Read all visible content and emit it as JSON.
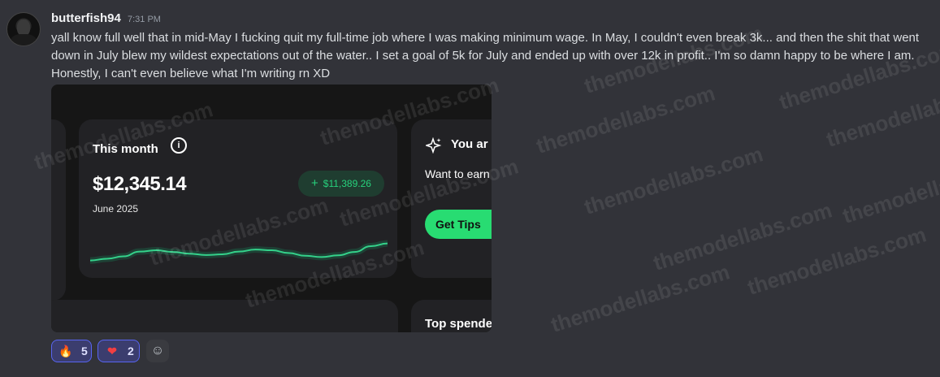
{
  "message": {
    "username": "butterfish94",
    "timestamp": "7:31 PM",
    "text": "yall know full well that in mid-May I fucking quit my full-time job where I was making minimum wage. In May, I couldn't even break 3k... and then the shit that went down in July blew my wildest expectations out of the water.. I set a goal of 5k for July and ended up with over 12k in profit.. I'm so damn happy to be where I am. Honestly, I can't even believe what I'm writing rn XD"
  },
  "embed": {
    "this_month_title": "This month",
    "info_icon": "i",
    "amount": "$12,345.14",
    "month": "June 2025",
    "gain_badge": "$11,389.26",
    "gain_plus": "+",
    "right_title": "You ar",
    "right_text": "Want to earn increased re",
    "tips_button": "Get Tips",
    "top_spend": "Top spende",
    "sparkline_values": [
      0.2,
      0.25,
      0.32,
      0.46,
      0.5,
      0.45,
      0.4,
      0.36,
      0.38,
      0.46,
      0.52,
      0.5,
      0.42,
      0.34,
      0.3,
      0.35,
      0.45,
      0.62,
      0.7
    ]
  },
  "reactions": [
    {
      "emoji": "🔥",
      "count": "5"
    },
    {
      "emoji": "❤",
      "count": "2"
    }
  ],
  "add_reaction_icon": "☺",
  "watermark_text": "themodellabs.com",
  "colors": {
    "background": "#323339",
    "accent_green": "#28dc72",
    "reaction_border": "#5865f2"
  }
}
